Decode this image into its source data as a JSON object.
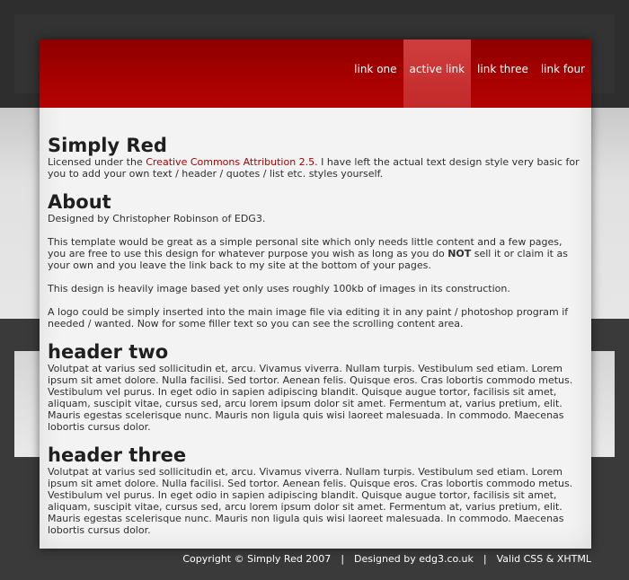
{
  "nav": {
    "items": [
      {
        "label": "link one"
      },
      {
        "label": "active link"
      },
      {
        "label": "link three"
      },
      {
        "label": "link four"
      }
    ]
  },
  "content": {
    "title": "Simply Red",
    "license_prefix": "Licensed under the ",
    "license_link": "Creative Commons Attribution 2.5",
    "license_suffix": ". I have left the actual text design style very basic for you to add your own text / header / quotes / list etc. styles yourself.",
    "about_title": "About",
    "about_p1": "Designed by Christopher Robinson of EDG3.",
    "about_p2_pre": "This template would be great as a simple personal site which only needs little content and a few pages, you are free to use this design for whatever purpose you wish as long as you do ",
    "about_p2_strong": "NOT",
    "about_p2_post": " sell it or claim it as your own and you leave the link back to my site at the bottom of your pages.",
    "about_p3": "This design is heavily image based yet only uses roughly 100kb of images in its construction.",
    "about_p4": "A logo could be simply inserted into the main image file via editing it in any paint / photoshop program if needed / wanted. Now for some filler text so you can see the scrolling content area.",
    "h2_title": "header two",
    "h2_text": "Volutpat at varius sed sollicitudin et, arcu. Vivamus viverra. Nullam turpis. Vestibulum sed etiam. Lorem ipsum sit amet dolore. Nulla facilisi. Sed tortor. Aenean felis. Quisque eros. Cras lobortis commodo metus. Vestibulum vel purus. In eget odio in sapien adipiscing blandit. Quisque augue tortor, facilisis sit amet, aliquam, suscipit vitae, cursus sed, arcu lorem ipsum dolor sit amet. Fermentum at, varius pretium, elit. Mauris egestas scelerisque nunc. Mauris non ligula quis wisi laoreet malesuada. In commodo. Maecenas lobortis cursus dolor.",
    "h3_title": "header three",
    "h3_text": "Volutpat at varius sed sollicitudin et, arcu. Vivamus viverra. Nullam turpis. Vestibulum sed etiam. Lorem ipsum sit amet dolore. Nulla facilisi. Sed tortor. Aenean felis. Quisque eros. Cras lobortis commodo metus. Vestibulum vel purus. In eget odio in sapien adipiscing blandit. Quisque augue tortor, facilisis sit amet, aliquam, suscipit vitae, cursus sed, arcu lorem ipsum dolor sit amet. Fermentum at, varius pretium, elit. Mauris egestas scelerisque nunc. Mauris non ligula quis wisi laoreet malesuada. In commodo. Maecenas lobortis cursus dolor."
  },
  "footer": {
    "copyright": "Copyright © Simply Red 2007",
    "separator": "|",
    "designed": "Designed by edg3.co.uk",
    "valid": "Valid CSS & XHTML"
  },
  "colors": {
    "accent": "#a80000",
    "header_dark": "#8e0000",
    "active_tab": "#c42a2a",
    "page_bg": "#f3f3f3",
    "outer_bg": "#3a3a3a"
  }
}
